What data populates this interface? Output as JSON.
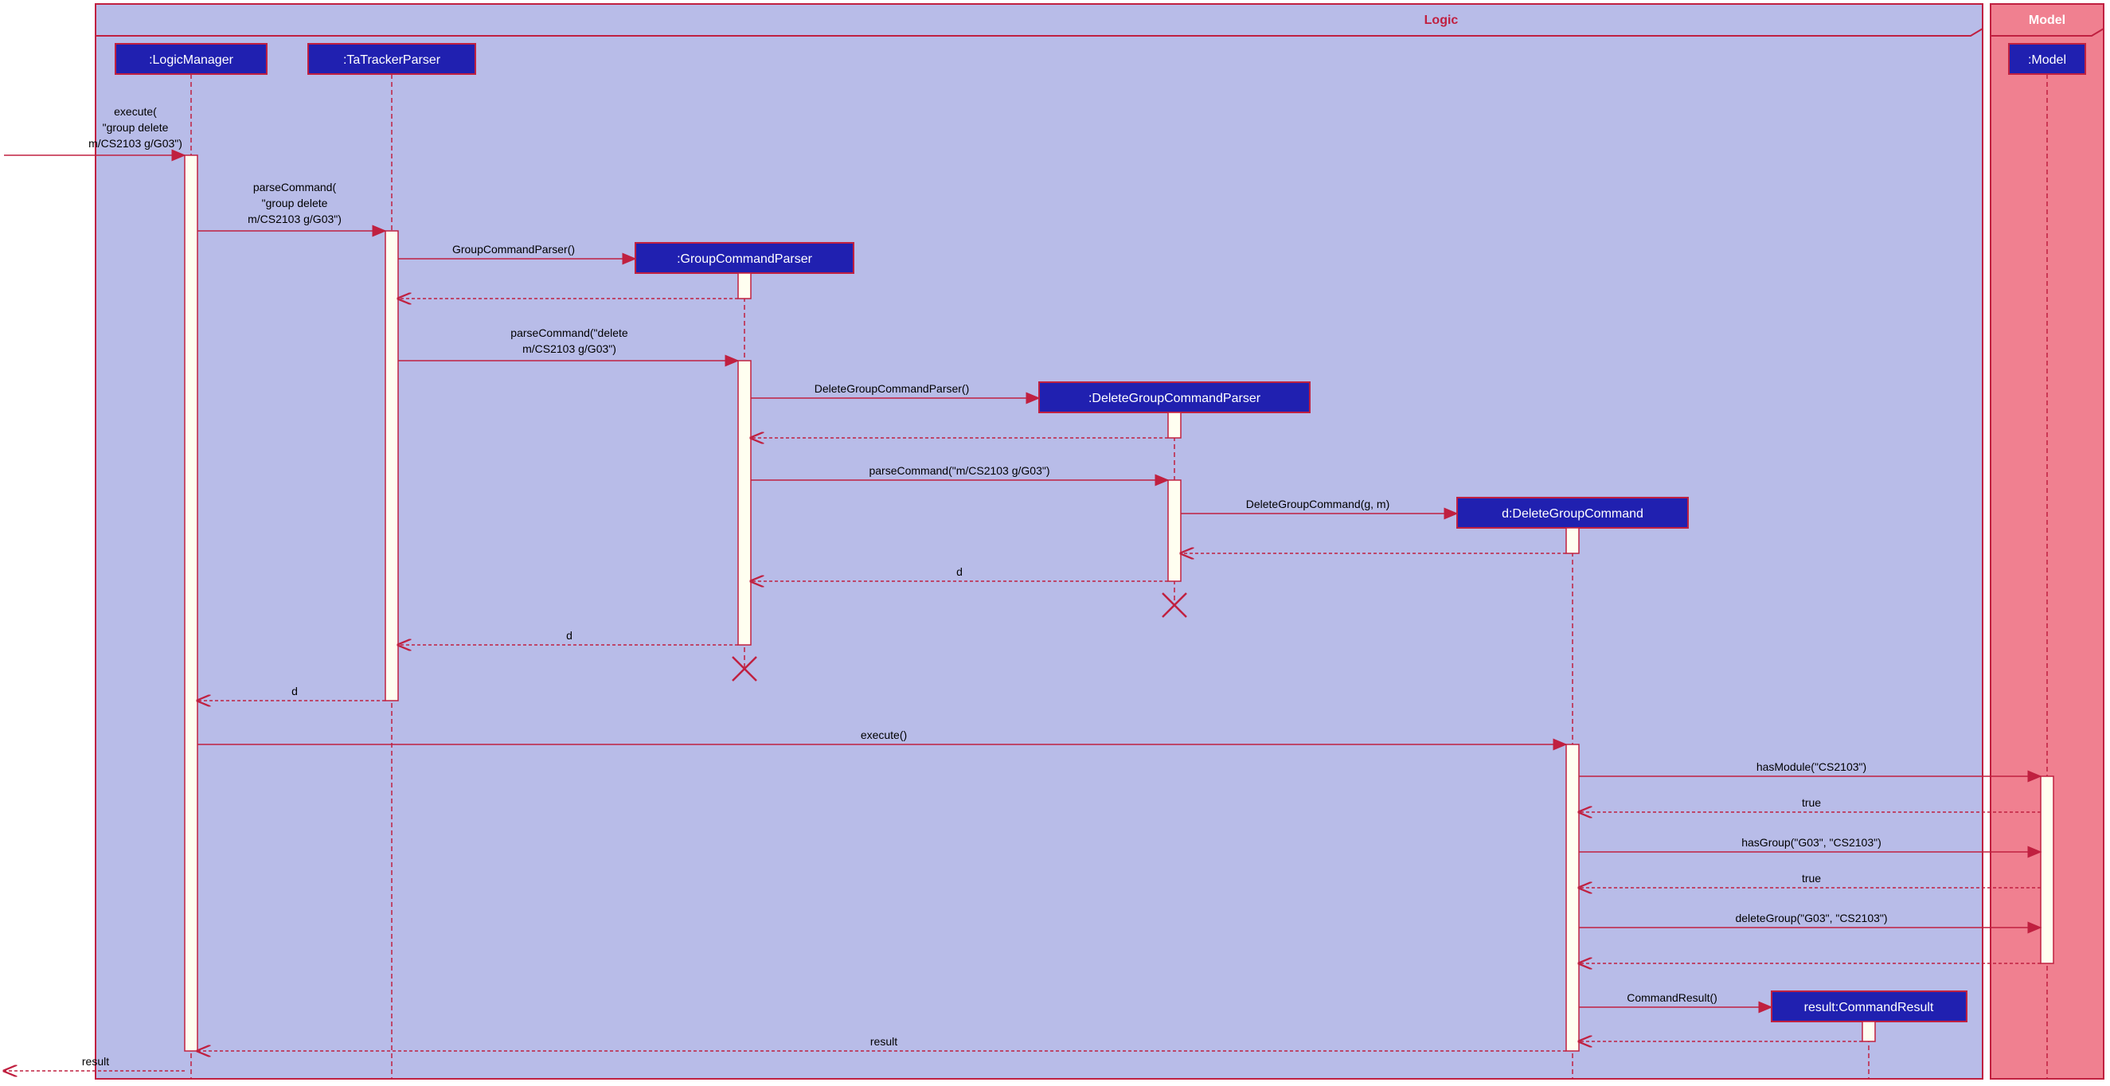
{
  "frames": {
    "logic": "Logic",
    "model": "Model"
  },
  "lifelines": {
    "logicManager": ":LogicManager",
    "taTrackerParser": ":TaTrackerParser",
    "groupCommandParser": ":GroupCommandParser",
    "deleteGroupCommandParser": ":DeleteGroupCommandParser",
    "deleteGroupCommand": "d:DeleteGroupCommand",
    "commandResult": "result:CommandResult",
    "model": ":Model"
  },
  "messages": {
    "m1_l1": "execute(",
    "m1_l2": "\"group delete",
    "m1_l3": "m/CS2103 g/G03\")",
    "m2_l1": "parseCommand(",
    "m2_l2": "\"group delete",
    "m2_l3": "m/CS2103 g/G03\")",
    "m3": "GroupCommandParser()",
    "m4_l1": "parseCommand(\"delete",
    "m4_l2": "m/CS2103 g/G03\")",
    "m5": "DeleteGroupCommandParser()",
    "m6": "parseCommand(\"m/CS2103 g/G03\")",
    "m7": "DeleteGroupCommand(g, m)",
    "m8": "d",
    "m9": "d",
    "m10": "d",
    "m11": "execute()",
    "m12": "hasModule(\"CS2103\")",
    "m13": "true",
    "m14": "hasGroup(\"G03\", \"CS2103\")",
    "m15": "true",
    "m16": "deleteGroup(\"G03\", \"CS2103\")",
    "m17": "CommandResult()",
    "m18": "result",
    "m19": "result"
  }
}
